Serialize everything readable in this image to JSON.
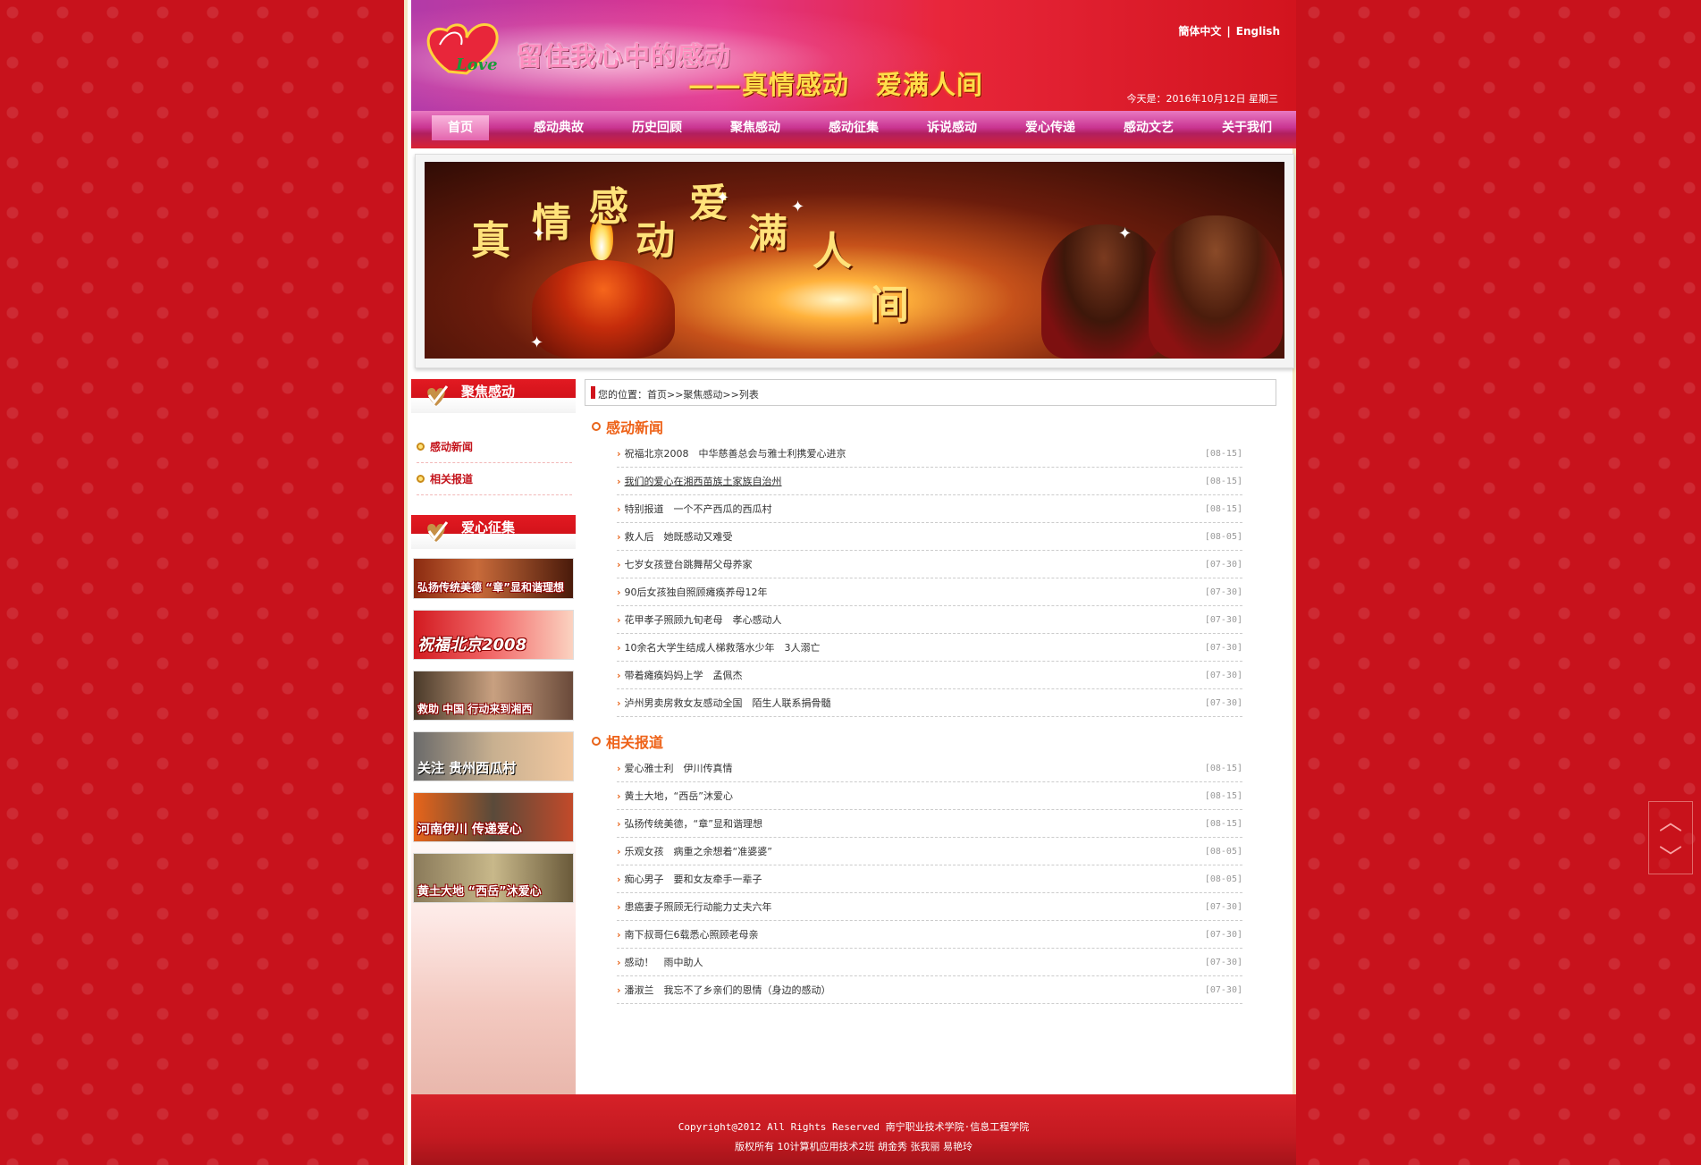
{
  "header": {
    "slogan_line1": "留住我心中的感动",
    "slogan_line2": "——真情感动　爱满人间",
    "logo_text": "Love",
    "lang_cn": "簡体中文",
    "lang_sep": "|",
    "lang_en": "English",
    "date": "今天是：2016年10月12日 星期三"
  },
  "nav": {
    "items": [
      "首页",
      "感动典故",
      "历史回顾",
      "聚焦感动",
      "感动征集",
      "诉说感动",
      "爱心传递",
      "感动文艺",
      "关于我们"
    ]
  },
  "banner": {
    "chars": [
      "真",
      "情",
      "感",
      "动",
      "爱",
      "满",
      "人",
      "间"
    ]
  },
  "sidebar": {
    "focus_title": "聚焦感动",
    "focus_items": [
      "感动新闻",
      "相关报道"
    ],
    "collect_title": "爱心征集",
    "thumbs": [
      "弘扬传统美德 “章”显和谐理想",
      "祝福北京2008",
      "救助 中国 行动来到湘西",
      "关注 贵州西瓜村",
      "河南伊川 传递爱心",
      "黄土大地 “西岳”沐爱心"
    ]
  },
  "breadcrumb": "您的位置：首页>>聚焦感动>>列表",
  "sections": [
    {
      "title": "感动新闻",
      "items": [
        {
          "title": "祝福北京2008　中华慈善总会与雅士利携爱心进京",
          "date": "[08-15]"
        },
        {
          "title": "我们的爱心在湘西苗族土家族自治州",
          "date": "[08-15]"
        },
        {
          "title": "特别报道　一个不产西瓜的西瓜村",
          "date": "[08-15]"
        },
        {
          "title": "救人后　她既感动又难受",
          "date": "[08-05]"
        },
        {
          "title": "七岁女孩登台跳舞帮父母养家",
          "date": "[07-30]"
        },
        {
          "title": "90后女孩独自照顾瘫痪养母12年",
          "date": "[07-30]"
        },
        {
          "title": "花甲孝子照顾九旬老母　孝心感动人",
          "date": "[07-30]"
        },
        {
          "title": "10余名大学生结成人梯救落水少年　3人溺亡",
          "date": "[07-30]"
        },
        {
          "title": "带着瘫痪妈妈上学　孟佩杰",
          "date": "[07-30]"
        },
        {
          "title": "泸州男卖房救女友感动全国　陌生人联系捐骨髓",
          "date": "[07-30]"
        }
      ]
    },
    {
      "title": "相关报道",
      "items": [
        {
          "title": "爱心雅士利　伊川传真情",
          "date": "[08-15]"
        },
        {
          "title": "黄土大地，“西岳”沐爱心",
          "date": "[08-15]"
        },
        {
          "title": "弘扬传统美德，“章”显和谐理想",
          "date": "[08-15]"
        },
        {
          "title": "乐观女孩　病重之余想着“准婆婆”",
          "date": "[08-05]"
        },
        {
          "title": "痴心男子　要和女友牵手一辈子",
          "date": "[08-05]"
        },
        {
          "title": "患癌妻子照顾无行动能力丈夫六年",
          "date": "[07-30]"
        },
        {
          "title": "南下叔哥仨6载悉心照顾老母亲",
          "date": "[07-30]"
        },
        {
          "title": "感动！　雨中助人",
          "date": "[07-30]"
        },
        {
          "title": "潘淑兰　我忘不了乡亲们的恩情（身边的感动）",
          "date": "[07-30]"
        }
      ]
    }
  ],
  "footer": {
    "line1": "Copyright@2012 All Rights Reserved 南宁职业技术学院·信息工程学院",
    "line2": "版权所有 10计算机应用技术2班 胡金秀 张我丽 易艳玲"
  },
  "colors": {
    "brand_red": "#d0141c",
    "accent_orange": "#ee6218",
    "nav_pink": "#c93491"
  }
}
